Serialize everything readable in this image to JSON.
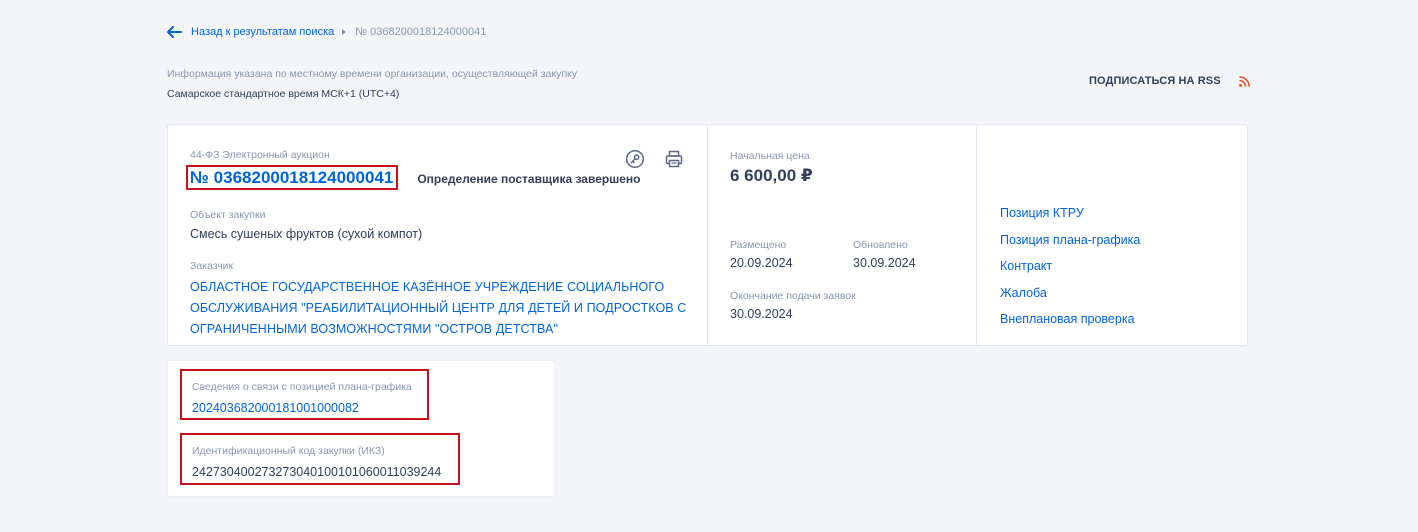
{
  "breadcrumb": {
    "back_label": "Назад к результатам поиска",
    "current": "№ 0368200018124000041"
  },
  "timezone": {
    "label": "Информация указана по местному времени организации, осуществляющей закупку",
    "value": "Самарское стандартное время МСК+1 (UTC+4)"
  },
  "rss": {
    "label": "ПОДПИСАТЬСЯ НА RSS",
    "icon": "rss-icon",
    "color": "#e8542c"
  },
  "purchase": {
    "type": "44-ФЗ Электронный аукцион",
    "number": "№ 0368200018124000041",
    "status": "Определение поставщика завершено",
    "object_label": "Объект закупки",
    "object_value": "Смесь сушеных фруктов (сухой компот)",
    "customer_label": "Заказчик",
    "customer_name": "ОБЛАСТНОЕ ГОСУДАРСТВЕННОЕ КАЗЁННОЕ УЧРЕЖДЕНИЕ СОЦИАЛЬНОГО ОБСЛУЖИВАНИЯ \"РЕАБИЛИТАЦИОННЫЙ ЦЕНТР ДЛЯ ДЕТЕЙ И ПОДРОСТКОВ С ОГРАНИЧЕННЫМИ ВОЗМОЖНОСТЯМИ \"ОСТРОВ ДЕТСТВА\"",
    "icons": [
      "key-icon",
      "print-icon"
    ]
  },
  "price": {
    "label": "Начальная цена",
    "value": "6 600,00 ₽"
  },
  "dates": {
    "placed_label": "Размещено",
    "placed_value": "20.09.2024",
    "updated_label": "Обновлено",
    "updated_value": "30.09.2024",
    "deadline_label": "Окончание подачи заявок",
    "deadline_value": "30.09.2024"
  },
  "links": [
    "Позиция КТРУ",
    "Позиция плана-графика",
    "Контракт",
    "Жалоба",
    "Внеплановая проверка"
  ],
  "plan": {
    "label": "Сведения о связи с позицией плана-графика",
    "value": "202403682000181001000082"
  },
  "ikz": {
    "label": "Идентификационный код закупки (ИКЗ)",
    "value": "242730400273273040100101060011039244"
  },
  "colors": {
    "link": "#0065dd",
    "text": "#334059",
    "muted": "#8a97b1",
    "highlight_border": "#c8101a",
    "background": "#f4f5f8"
  }
}
